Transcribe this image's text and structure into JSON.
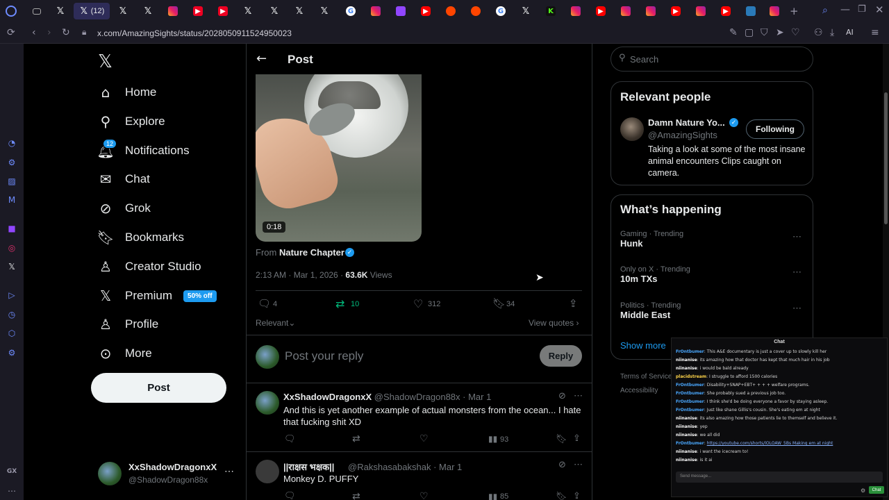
{
  "browser": {
    "url": "x.com/AmazingSights/status/2028050911524950023",
    "active_tab_label": "(12)",
    "ai_label": "AI",
    "gx_label": "GX"
  },
  "nav": {
    "items": [
      {
        "label": "Home",
        "icon": "home-icon"
      },
      {
        "label": "Explore",
        "icon": "search-icon"
      },
      {
        "label": "Notifications",
        "icon": "bell-icon"
      },
      {
        "label": "Chat",
        "icon": "mail-icon"
      },
      {
        "label": "Grok",
        "icon": "grok-icon"
      },
      {
        "label": "Bookmarks",
        "icon": "bookmark-icon"
      },
      {
        "label": "Creator Studio",
        "icon": "creator-studio-icon"
      },
      {
        "label": "Premium",
        "icon": "x-premium-icon"
      },
      {
        "label": "Profile",
        "icon": "person-icon"
      },
      {
        "label": "More",
        "icon": "more-circle-icon"
      }
    ],
    "notifications_badge": "12",
    "premium_badge": "50% off",
    "post_button": "Post",
    "account": {
      "name": "XxShadowDragonxX",
      "handle": "@ShadowDragon88x"
    }
  },
  "post": {
    "header_title": "Post",
    "video_duration": "0:18",
    "from_prefix": "From",
    "from_source": "Nature Chapter",
    "timestamp": "2:13 AM · Mar 1, 2026 ·",
    "views_count": "63.6K",
    "views_label": "Views",
    "replies": "4",
    "reposts": "10",
    "likes": "312",
    "bookmarks": "34",
    "sort_label": "Relevant",
    "view_quotes": "View quotes",
    "reply_placeholder": "Post your reply",
    "reply_button": "Reply"
  },
  "replies": [
    {
      "name": "XxShadowDragonxX",
      "handle": "@ShadowDragon88x · Mar 1",
      "text": "And this is yet another example of actual monsters from the ocean... I hate that fucking shit XD",
      "views": "93"
    },
    {
      "name": "||राक्षस भक्षक||",
      "handle": "@Rakshasabakshak · Mar 1",
      "text": "Monkey D. PUFFY",
      "views": "85"
    }
  ],
  "sidebar": {
    "search_placeholder": "Search",
    "relevant_title": "Relevant people",
    "person": {
      "name": "Damn Nature Yo...",
      "handle": "@AmazingSights",
      "bio": "Taking a look at some of the most insane animal encounters Clips caught on camera.",
      "follow_label": "Following"
    },
    "happening_title": "What’s happening",
    "trends": [
      {
        "context": "Gaming · Trending",
        "name": "Hunk"
      },
      {
        "context": "Only on X · Trending",
        "name": "10m TXs"
      },
      {
        "context": "Politics · Trending",
        "name": "Middle East"
      }
    ],
    "show_more": "Show more",
    "footer": [
      "Terms of Service",
      "Accessibility"
    ]
  },
  "chat": {
    "title": "Chat",
    "messages": [
      {
        "user": "FrOntbumer",
        "text": "This A&E documentary is just a cover up to slowly kill her"
      },
      {
        "user": "niinanise",
        "text": "its amazing how that doctor has kept that much hair in his job"
      },
      {
        "user": "niinanise",
        "text": "i would be bald already"
      },
      {
        "user": "placidstream",
        "text": "I struggle to afford 1500 calories"
      },
      {
        "user": "FrOntbumer",
        "text": "Disability+SNAP+EBT+ + + + welfare programs."
      },
      {
        "user": "FrOntbumer",
        "text": "She probably sued a previous job too."
      },
      {
        "user": "FrOntbumer",
        "text": "I think she'd be doing everyone a favor by staying asleep."
      },
      {
        "user": "FrOntbumer",
        "text": "Just like shane Gillis's cousin. She's eating em at night"
      },
      {
        "user": "niinanise",
        "text": "its also amazing how those patients lie to themself and believe it."
      },
      {
        "user": "niinanise",
        "text": "yep"
      },
      {
        "user": "niinanise",
        "text": "we all did"
      },
      {
        "user": "FrOntbumer",
        "text": "https://youtube.com/shorts/lOLOAW_5Bs Making em at night"
      },
      {
        "user": "niinanise",
        "text": "i want the icecream to!"
      },
      {
        "user": "niinanise",
        "text": "is it ai"
      }
    ],
    "input_placeholder": "Send message...",
    "send_label": "Chat"
  }
}
